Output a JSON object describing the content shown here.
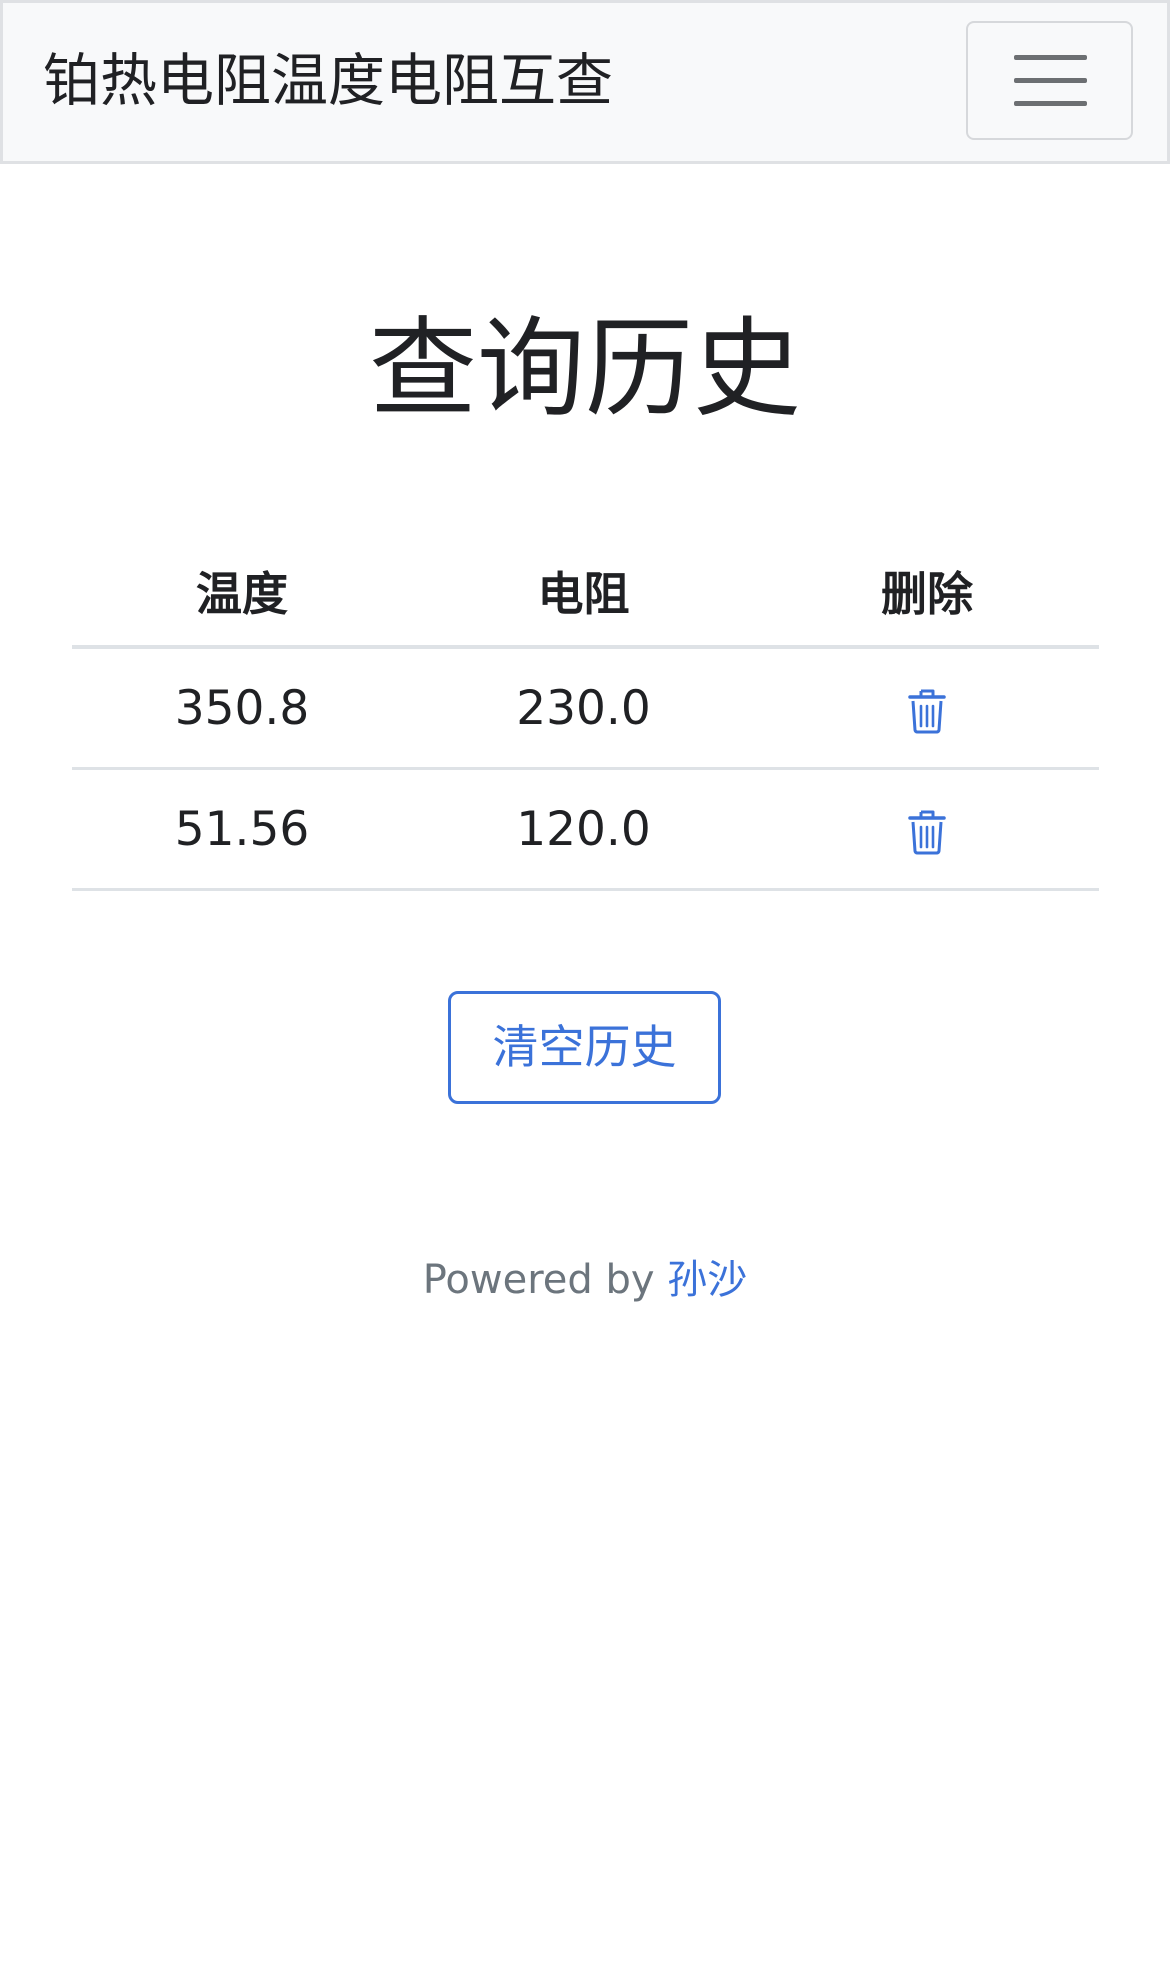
{
  "navbar": {
    "brand": "铂热电阻温度电阻互查",
    "toggler_icon": "hamburger-menu-icon"
  },
  "page": {
    "title": "查询历史"
  },
  "table": {
    "headers": [
      "温度",
      "电阻",
      "删除"
    ],
    "rows": [
      {
        "temperature": "350.8",
        "resistance": "230.0",
        "delete_icon": "trash-icon"
      },
      {
        "temperature": "51.56",
        "resistance": "120.0",
        "delete_icon": "trash-icon"
      }
    ]
  },
  "actions": {
    "clear_label": "清空历史"
  },
  "footer": {
    "prefix": "Powered by ",
    "author": "孙沙"
  },
  "colors": {
    "accent": "#3b72d9",
    "navbar_bg": "#f8f9fa",
    "muted_text": "#6c757d",
    "divider": "#dee2e6"
  }
}
